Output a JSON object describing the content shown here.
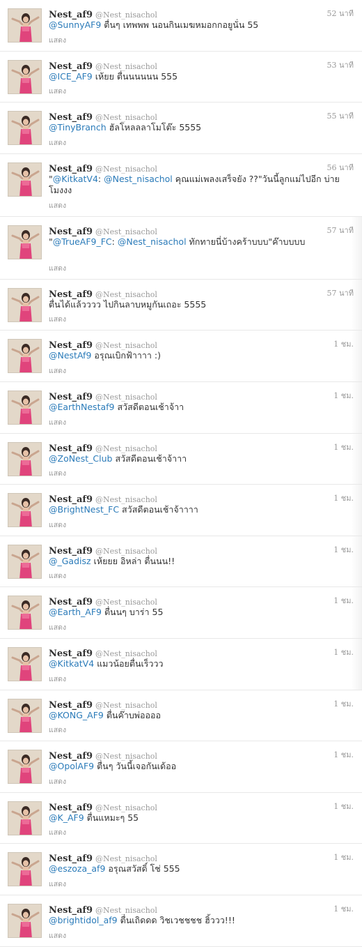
{
  "user": {
    "name": "Nest_af9",
    "handle": "@Nest_nisachol"
  },
  "action_label": "แสดง",
  "tweets": [
    {
      "time": "52 นาที",
      "mention": "@SunnyAF9",
      "text": " ตื่นๆ เทพพพ นอนกินเมฆหมอกกอยูนั่น 55"
    },
    {
      "time": "53 นาที",
      "mention": "@ICE_AF9",
      "text": " เห้ยย ตื่นนนนนน 555"
    },
    {
      "time": "55 นาที",
      "mention": "@TinyBranch",
      "text": " ฮัลโหลลลาโมโต๊ะ 5555"
    },
    {
      "time": "56 นาที",
      "prefix": "\"",
      "mention": "@KitkatV4",
      "mid": ": ",
      "mention2": "@Nest_nisachol",
      "text": " คุณแม่เพลงเสร็จยัง ??\"วันนี้ลูกแม่ไปอีก บ่ายโมงงง"
    },
    {
      "time": "57 นาที",
      "prefix": "\"",
      "mention": "@TrueAF9_FC",
      "mid": ": ",
      "mention2": "@Nest_nisachol",
      "text": " ทักทายนี่บ้างคร้าบบบ\"ค๊าบบบบ"
    },
    {
      "time": "57 นาที",
      "mention": "",
      "text": "ตื่นได้แล้วววว ไปกินลาบหมูกันเถอะ 5555"
    },
    {
      "time": "1 ชม.",
      "mention": "@NestAf9",
      "text": " อรุณเบิกฟ้าาาา :)"
    },
    {
      "time": "1 ชม.",
      "mention": "@EarthNestaf9",
      "text": " สวัสดีตอนเช้าจ้าา"
    },
    {
      "time": "1 ชม.",
      "mention": "@ZoNest_Club",
      "text": " สวัสดีตอนเช้าจ้าาา"
    },
    {
      "time": "1 ชม.",
      "mention": "@BrightNest_FC",
      "text": " สวัสดีตอนเช้าจ้าาาา"
    },
    {
      "time": "1 ชม.",
      "mention": "@_Gadisz",
      "text": " เห้ยยย อิหล่า ตื่นนน!!"
    },
    {
      "time": "1 ชม.",
      "mention": "@Earth_AF9",
      "text": " ตื่นนๆ บาร่า 55"
    },
    {
      "time": "1 ชม.",
      "mention": "@KitkatV4",
      "text": " แมวน้อยตื่นเร็ววว"
    },
    {
      "time": "1 ชม.",
      "mention": "@KONG_AF9",
      "text": " ตื่นค๊าบพ่ออออ"
    },
    {
      "time": "1 ชม.",
      "mention": "@OpolAF9",
      "text": " ตื่นๆ วันนี้เจอกันเด้ออ"
    },
    {
      "time": "1 ชม.",
      "mention": "@K_AF9",
      "text": " ตื่นแหมะๆ 55"
    },
    {
      "time": "1 ชม.",
      "mention": "@eszoza_af9",
      "text": " อรุณสวัสดิ์ โช่ 555"
    },
    {
      "time": "1 ชม.",
      "mention": "@brightidol_af9",
      "text": " ตื่นเถิดดด วิชเวชชชช ฮิ้ววว!!!"
    }
  ]
}
